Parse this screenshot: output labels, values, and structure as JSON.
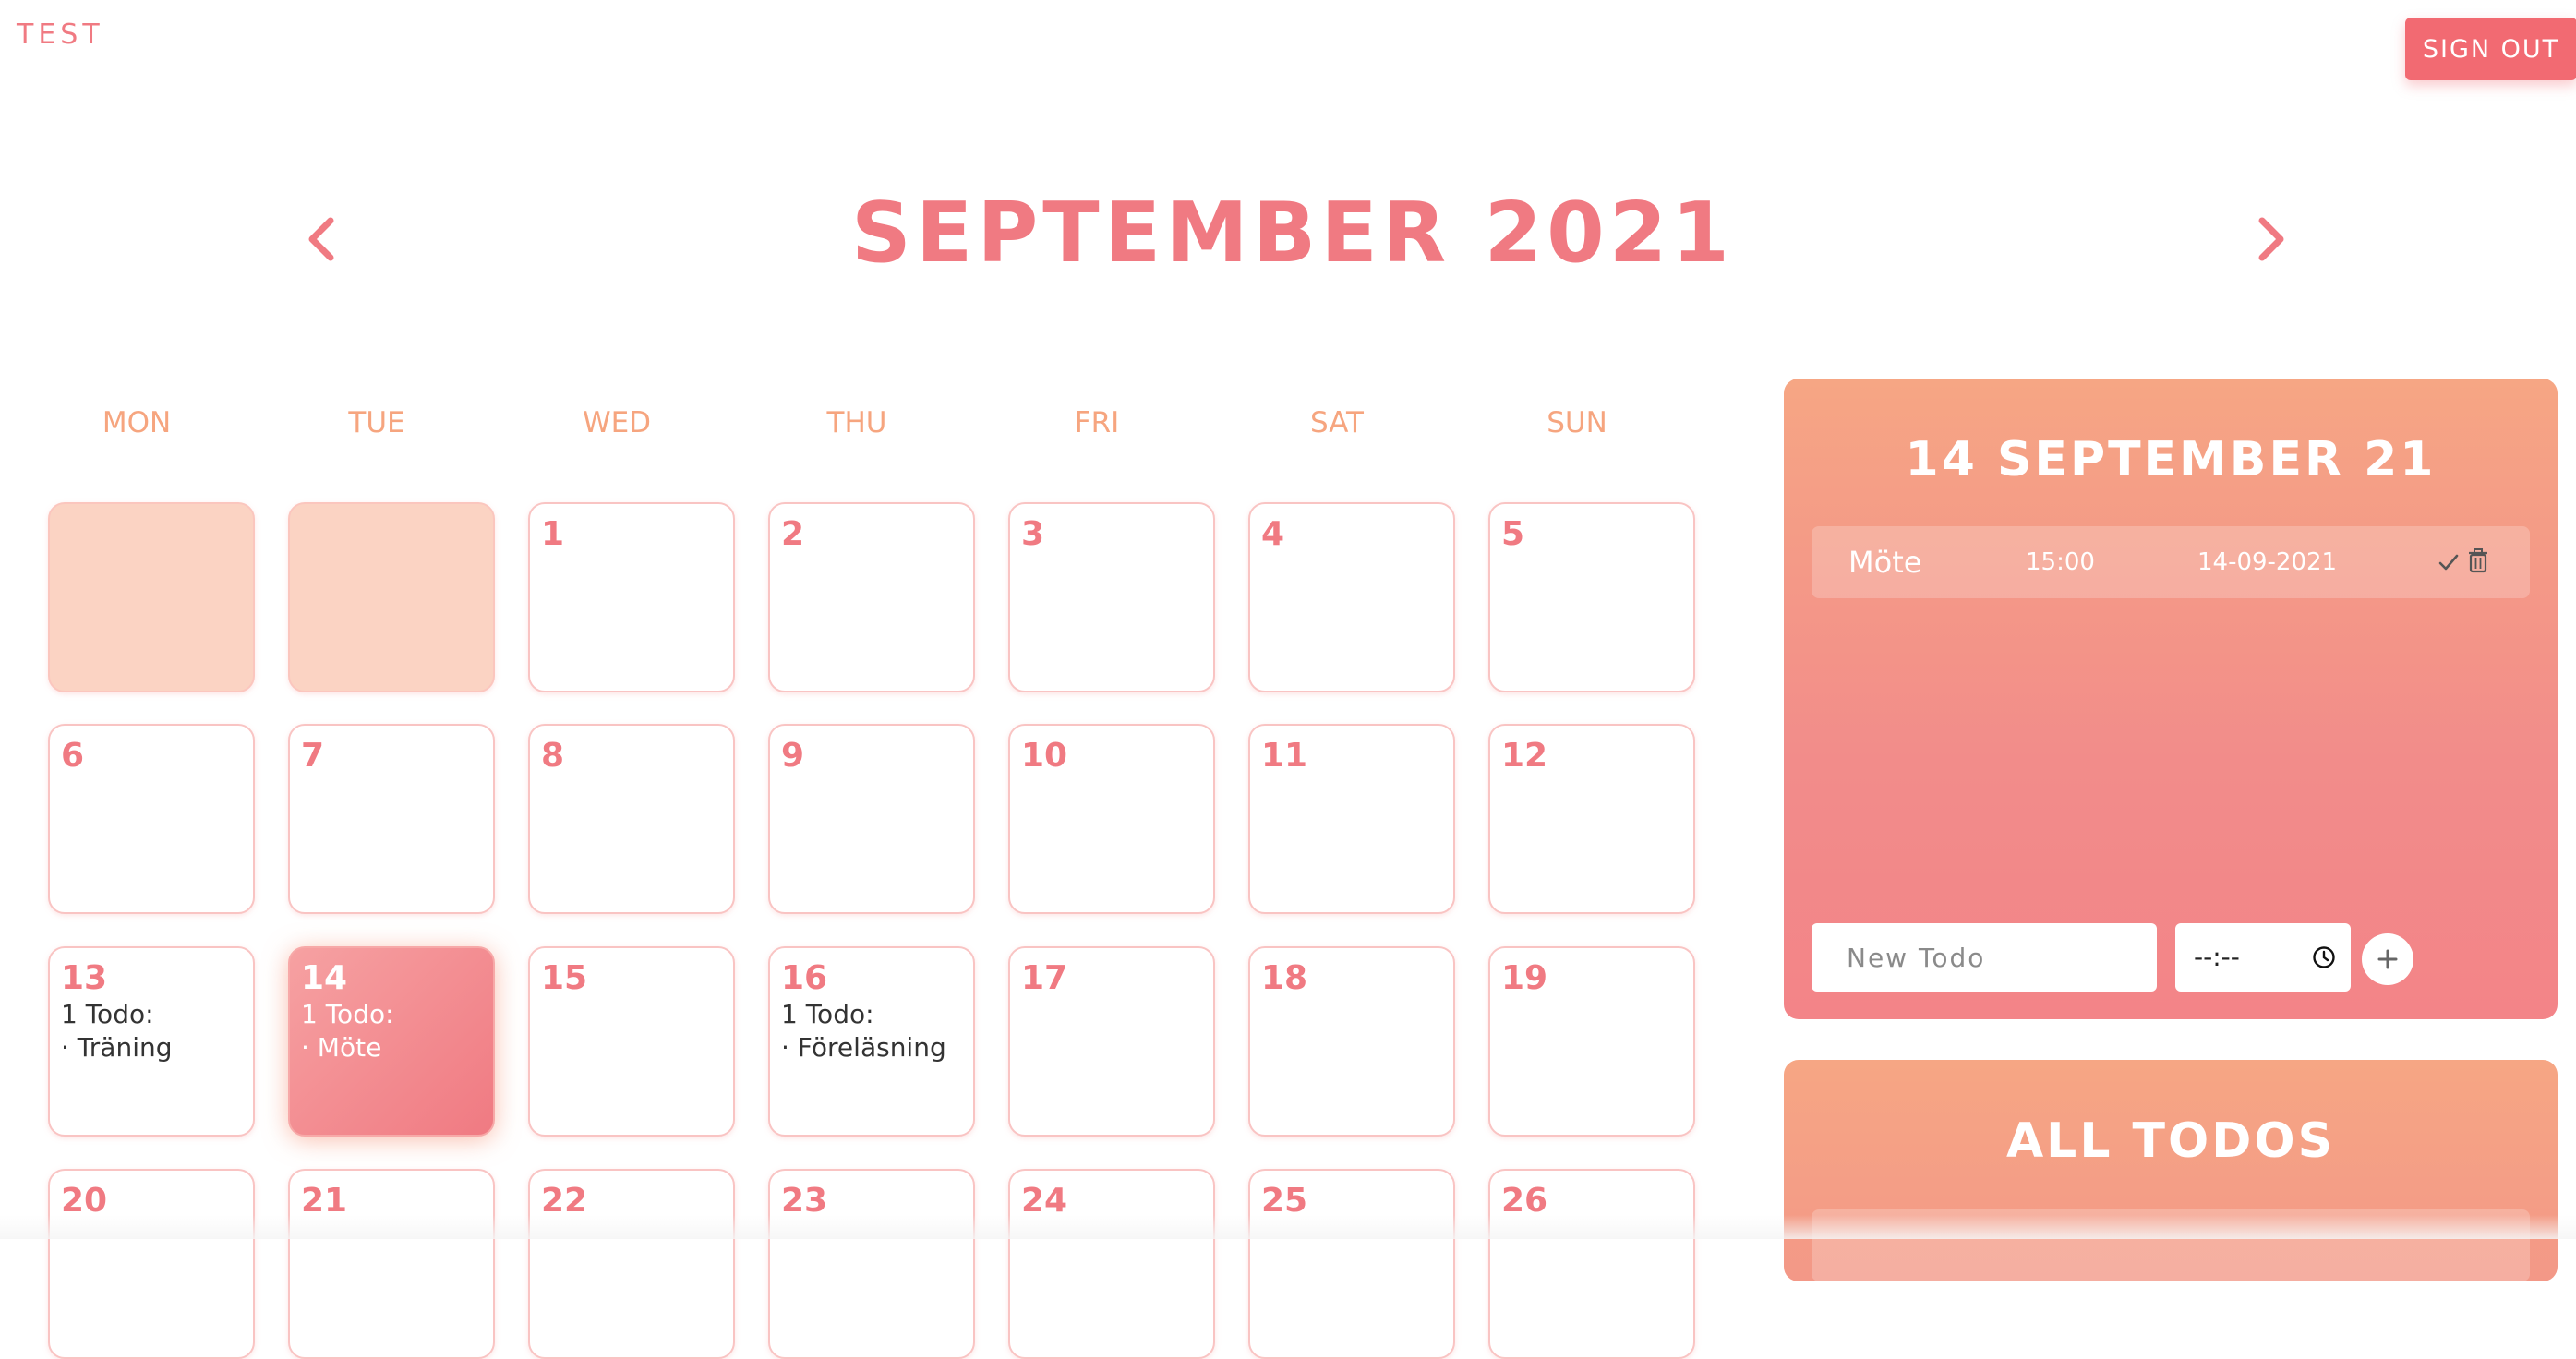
{
  "header": {
    "brand": "TEST",
    "signout_label": "SIGN OUT"
  },
  "calendar": {
    "month_title": "SEPTEMBER 2021",
    "weekdays": [
      "MON",
      "TUE",
      "WED",
      "THU",
      "FRI",
      "SAT",
      "SUN"
    ],
    "days": [
      {
        "num": "",
        "empty": true
      },
      {
        "num": "",
        "empty": true
      },
      {
        "num": "1"
      },
      {
        "num": "2"
      },
      {
        "num": "3"
      },
      {
        "num": "4"
      },
      {
        "num": "5"
      },
      {
        "num": "6"
      },
      {
        "num": "7"
      },
      {
        "num": "8"
      },
      {
        "num": "9"
      },
      {
        "num": "10"
      },
      {
        "num": "11"
      },
      {
        "num": "12"
      },
      {
        "num": "13",
        "todo_count": "1 Todo:",
        "todos": [
          "· Träning"
        ]
      },
      {
        "num": "14",
        "todo_count": "1 Todo:",
        "todos": [
          "· Möte"
        ],
        "selected": true
      },
      {
        "num": "15"
      },
      {
        "num": "16",
        "todo_count": "1 Todo:",
        "todos": [
          "· Föreläsning"
        ]
      },
      {
        "num": "17"
      },
      {
        "num": "18"
      },
      {
        "num": "19"
      },
      {
        "num": "20"
      },
      {
        "num": "21"
      },
      {
        "num": "22"
      },
      {
        "num": "23"
      },
      {
        "num": "24"
      },
      {
        "num": "25"
      },
      {
        "num": "26"
      }
    ]
  },
  "day_panel": {
    "title": "14 SEPTEMBER 21",
    "todos": [
      {
        "name": "Möte",
        "time": "15:00",
        "date": "14-09-2021"
      }
    ],
    "new_todo_placeholder": "New Todo",
    "time_value": "--:--"
  },
  "all_panel": {
    "title": "ALL TODOS"
  },
  "icons": {
    "prev": "chevron-left-icon",
    "next": "chevron-right-icon",
    "check": "check-icon",
    "trash": "trash-icon",
    "clock": "clock-icon",
    "add": "plus-icon"
  },
  "colors": {
    "accent": "#f07a82",
    "weekday": "#f6a57f",
    "signout_bg": "#f26a72",
    "panel_top": "#f6a684",
    "panel_bottom": "#f38488",
    "empty_cell": "#fbd3c3"
  }
}
